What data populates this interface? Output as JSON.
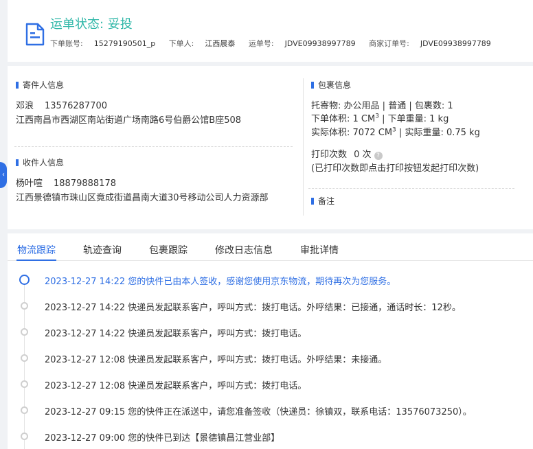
{
  "header": {
    "status_label": "运单状态: 妥投",
    "order_account_label": "下单账号:",
    "order_account": "15279190501_p",
    "orderer_label": "下单人:",
    "orderer": "江西晨泰",
    "waybill_label": "运单号:",
    "waybill": "JDVE09938997789",
    "merchant_order_label": "商家订单号:",
    "merchant_order": "JDVE09938997789"
  },
  "sender": {
    "title": "寄件人信息",
    "name": "邓浪",
    "phone": "13576287700",
    "address": "江西南昌市西湖区南站街道广场南路6号伯爵公馆B座508"
  },
  "receiver": {
    "title": "收件人信息",
    "name": "杨叶喧",
    "phone": "18879888178",
    "address": "江西景德镇市珠山区竟成街道昌南大道30号移动公司人力资源部"
  },
  "package": {
    "title": "包裹信息",
    "goods_label": "托寄物:",
    "goods": "办公用品",
    "service": "普通",
    "count_label": "包裹数:",
    "count": "1",
    "order_volume_label": "下单体积:",
    "order_volume": "1 CM",
    "order_weight_label": "下单重量:",
    "order_weight": "1 kg",
    "actual_volume_label": "实际体积:",
    "actual_volume": "7072 CM",
    "actual_weight_label": "实际重量:",
    "actual_weight": "0.75 kg",
    "print_count_label": "打印次数",
    "print_count": "0 次",
    "print_note": "(已打印次数即点击打印按钮发起打印次数)"
  },
  "remark": {
    "title": "备注"
  },
  "tabs": [
    "物流跟踪",
    "轨迹查询",
    "包裹跟踪",
    "修改日志信息",
    "审批详情"
  ],
  "tracking": [
    "2023-12-27 14:22 您的快件已由本人签收，感谢您使用京东物流，期待再次为您服务。",
    "2023-12-27 14:22 快递员发起联系客户，呼叫方式：拨打电话。外呼结果：已接通，通话时长：12秒。",
    "2023-12-27 14:22 快递员发起联系客户，呼叫方式：拨打电话。",
    "2023-12-27 12:08 快递员发起联系客户，呼叫方式：拨打电话。外呼结果：未接通。",
    "2023-12-27 12:08 快递员发起联系客户，呼叫方式：拨打电话。",
    "2023-12-27 09:15 您的快件正在派送中，请您准备签收（快递员：徐镇双，联系电话：13576073250）。",
    "2023-12-27 09:00 您的快件已到达【景德镇昌江营业部】"
  ],
  "colors": {
    "accent": "#2f6fe4",
    "status": "#2fb7a8"
  }
}
